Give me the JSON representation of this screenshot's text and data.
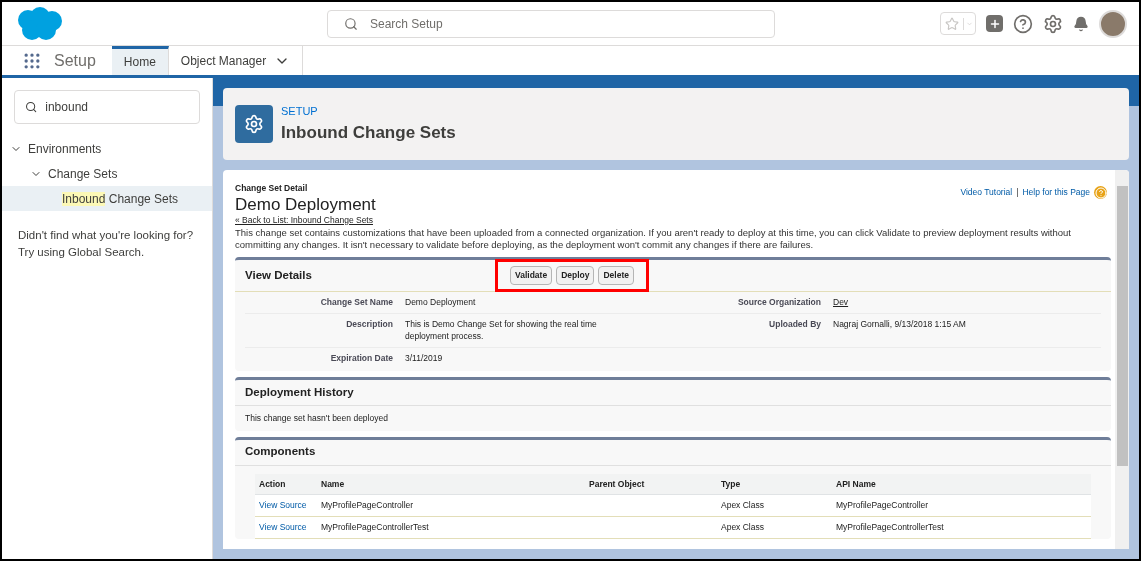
{
  "header": {
    "search": {
      "placeholder": "Search Setup"
    }
  },
  "nav": {
    "app_name": "Setup",
    "tabs": [
      {
        "label": "Home",
        "selected": true,
        "dropdown": false
      },
      {
        "label": "Object Manager",
        "selected": false,
        "dropdown": true
      }
    ]
  },
  "sidebar": {
    "search": {
      "value": "inbound"
    },
    "tree": [
      {
        "label": "Environments",
        "expanded": true,
        "selected": false,
        "children": [
          {
            "label": "Change Sets",
            "expanded": true,
            "selected": false,
            "children": [
              {
                "match": "Inbound",
                "label": "Change Sets",
                "selected": true
              }
            ]
          }
        ]
      }
    ],
    "hint_lines": [
      "Didn't find what you're looking for?",
      "Try using Global Search."
    ]
  },
  "page_header": {
    "eyebrow": "SETUP",
    "title": "Inbound Change Sets"
  },
  "detail": {
    "eyebrow": "Change Set Detail",
    "title": "Demo Deployment",
    "back_link": "« Back to List: Inbound Change Sets",
    "help_links": [
      "Video Tutorial",
      "Help for this Page"
    ],
    "help_separator": "|",
    "intro": "This change set contains customizations that have been uploaded from a connected organization. If you aren't ready to deploy at this time, you can click Validate to preview deployment results without committing any changes. It isn't necessary to validate before deploying, as the deployment won't commit any changes if there are failures.",
    "view_details": {
      "title": "View Details",
      "buttons": [
        "Validate",
        "Deploy",
        "Delete"
      ],
      "rows": [
        {
          "left": {
            "label": "Change Set Name",
            "value": "Demo Deployment",
            "link": false
          },
          "right": {
            "label": "Source Organization",
            "value": "Dev",
            "link": true
          }
        },
        {
          "left": {
            "label": "Description",
            "value": "This is Demo Change Set for showing the real time deployment process.",
            "link": false
          },
          "right": {
            "label": "Uploaded By",
            "value": "Nagraj Gornalli, 9/13/2018 1:15 AM",
            "link": false
          }
        },
        {
          "left": {
            "label": "Expiration Date",
            "value": "3/11/2019",
            "link": false
          }
        }
      ]
    },
    "history": {
      "title": "Deployment History",
      "message": "This change set hasn't been deployed"
    },
    "components": {
      "title": "Components",
      "columns": [
        "Action",
        "Name",
        "Parent Object",
        "Type",
        "API Name"
      ],
      "rows": [
        {
          "action": "View Source",
          "name": "MyProfilePageController",
          "parent_object": "",
          "type": "Apex Class",
          "api_name": "MyProfilePageController"
        },
        {
          "action": "View Source",
          "name": "MyProfilePageControllerTest",
          "parent_object": "",
          "type": "Apex Class",
          "api_name": "MyProfilePageControllerTest"
        }
      ]
    }
  }
}
